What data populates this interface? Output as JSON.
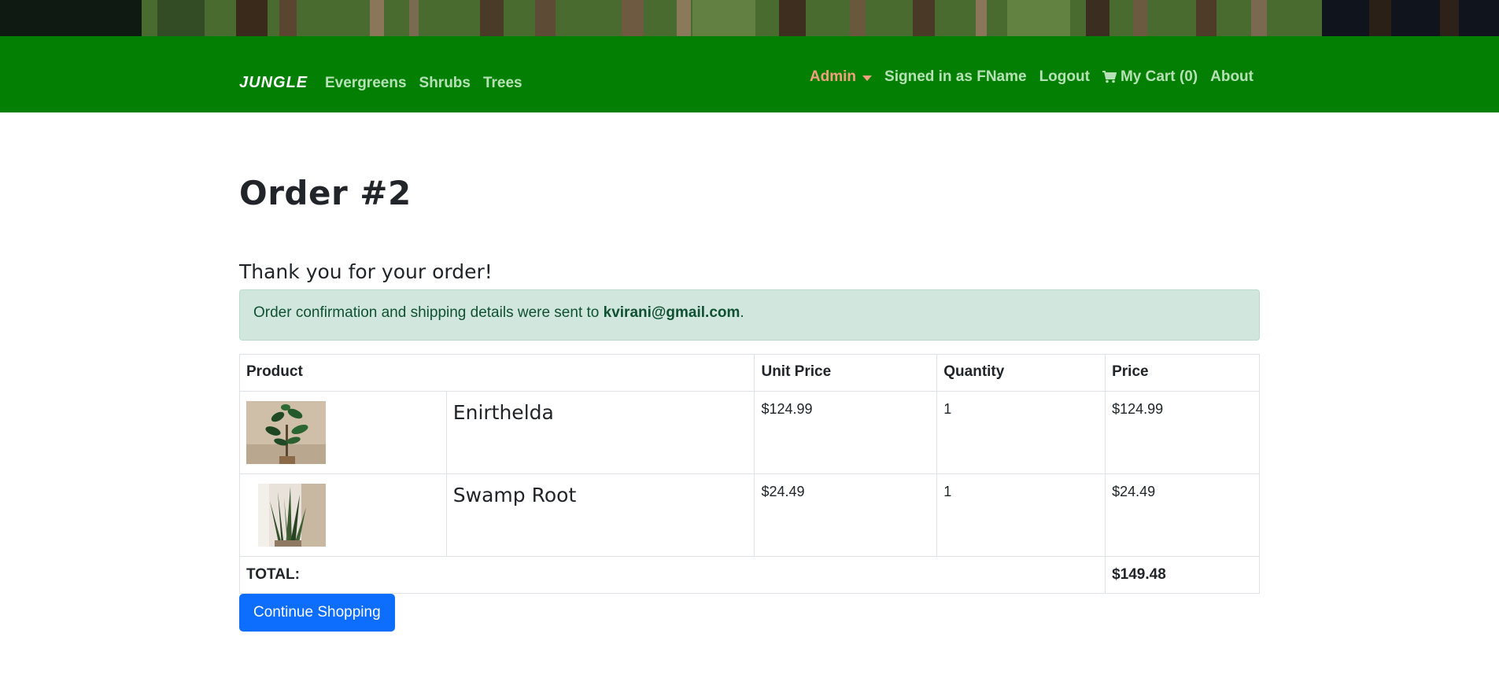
{
  "navbar": {
    "brand": "JUNGLE",
    "links": [
      "Evergreens",
      "Shrubs",
      "Trees"
    ],
    "admin_label": "Admin",
    "signed_in": "Signed in as FName",
    "logout": "Logout",
    "cart": "My Cart (0)",
    "about": "About"
  },
  "order": {
    "title": "Order #2",
    "thanks": "Thank you for your order!",
    "confirmation_prefix": "Order confirmation and shipping details were sent to ",
    "email": "kvirani@gmail.com",
    "confirmation_suffix": "."
  },
  "table": {
    "headers": {
      "product": "Product",
      "unit_price": "Unit Price",
      "quantity": "Quantity",
      "price": "Price"
    },
    "rows": [
      {
        "name": "Enirthelda",
        "unit_price": "$124.99",
        "quantity": "1",
        "price": "$124.99",
        "image": "plant-photo-enirthelda"
      },
      {
        "name": "Swamp Root",
        "unit_price": "$24.49",
        "quantity": "1",
        "price": "$24.49",
        "image": "plant-photo-swamp-root"
      }
    ],
    "total_label": "TOTAL:",
    "total_value": "$149.48"
  },
  "actions": {
    "continue_shopping": "Continue Shopping"
  },
  "colors": {
    "navbar": "#038003",
    "nav_link": "#b6e1b6",
    "admin": "#f4a07f",
    "alert_bg": "#d1e7dd",
    "alert_text": "#0f5132",
    "button": "#0d6efd"
  }
}
